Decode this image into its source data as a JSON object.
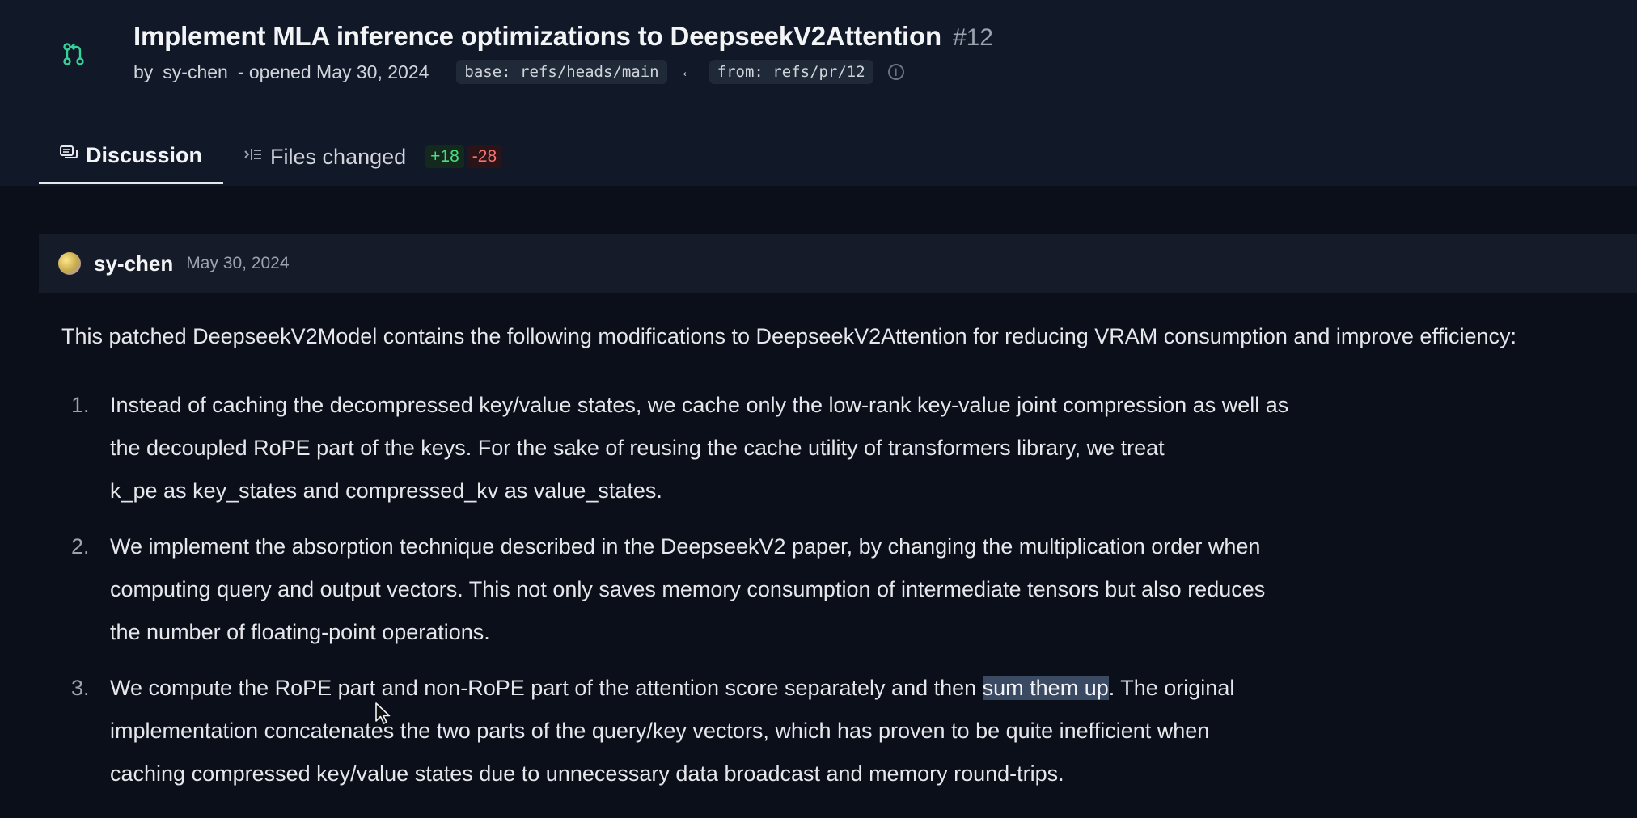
{
  "pr": {
    "title": "Implement MLA inference optimizations to DeepseekV2Attention",
    "number": "#12",
    "author": "sy-chen",
    "opened_text": "- opened May 30, 2024",
    "by_label": "by",
    "base_branch": "base: refs/heads/main",
    "arrow": "←",
    "from_branch": "from: refs/pr/12",
    "info_icon": "info-icon"
  },
  "tabs": [
    {
      "label": "Discussion",
      "icon": "discussion-icon",
      "active": true
    },
    {
      "label": "Files changed",
      "icon": "files-icon",
      "active": false
    }
  ],
  "diff": {
    "added": "+18",
    "removed": "-28"
  },
  "comment": {
    "author": "sy-chen",
    "date": "May 30, 2024",
    "intro": "This patched DeepseekV2Model contains the following modifications to DeepseekV2Attention for reducing VRAM consumption and improve efficiency:",
    "items": [
      {
        "num": "1.",
        "text": "Instead of caching the decompressed key/value states, we cache only the low-rank key-value joint compression as well as\nthe decoupled RoPE part of the keys. For the sake of reusing the cache utility of transformers library, we treat\nk_pe as key_states and compressed_kv as value_states."
      },
      {
        "num": "2.",
        "text": "We implement the absorption technique described in the DeepseekV2 paper, by changing the multiplication order when\ncomputing query and output vectors. This not only saves memory consumption of intermediate tensors but also reduces\nthe number of floating-point operations."
      },
      {
        "num": "3.",
        "text_before": "We compute the RoPE part and non-RoPE part of the attention score separately and then ",
        "highlight": "sum them up",
        "text_after": ". The original\nimplementation concatenates the two parts of the query/key vectors, which has proven to be quite inefficient when\ncaching compressed key/value states due to unnecessary data broadcast and memory round-trips."
      }
    ]
  },
  "colors": {
    "background": "#0b0f19",
    "header_bg": "#111827",
    "diff_add": "#4ade80",
    "diff_del": "#f87171",
    "selection": "#3b4a63"
  }
}
